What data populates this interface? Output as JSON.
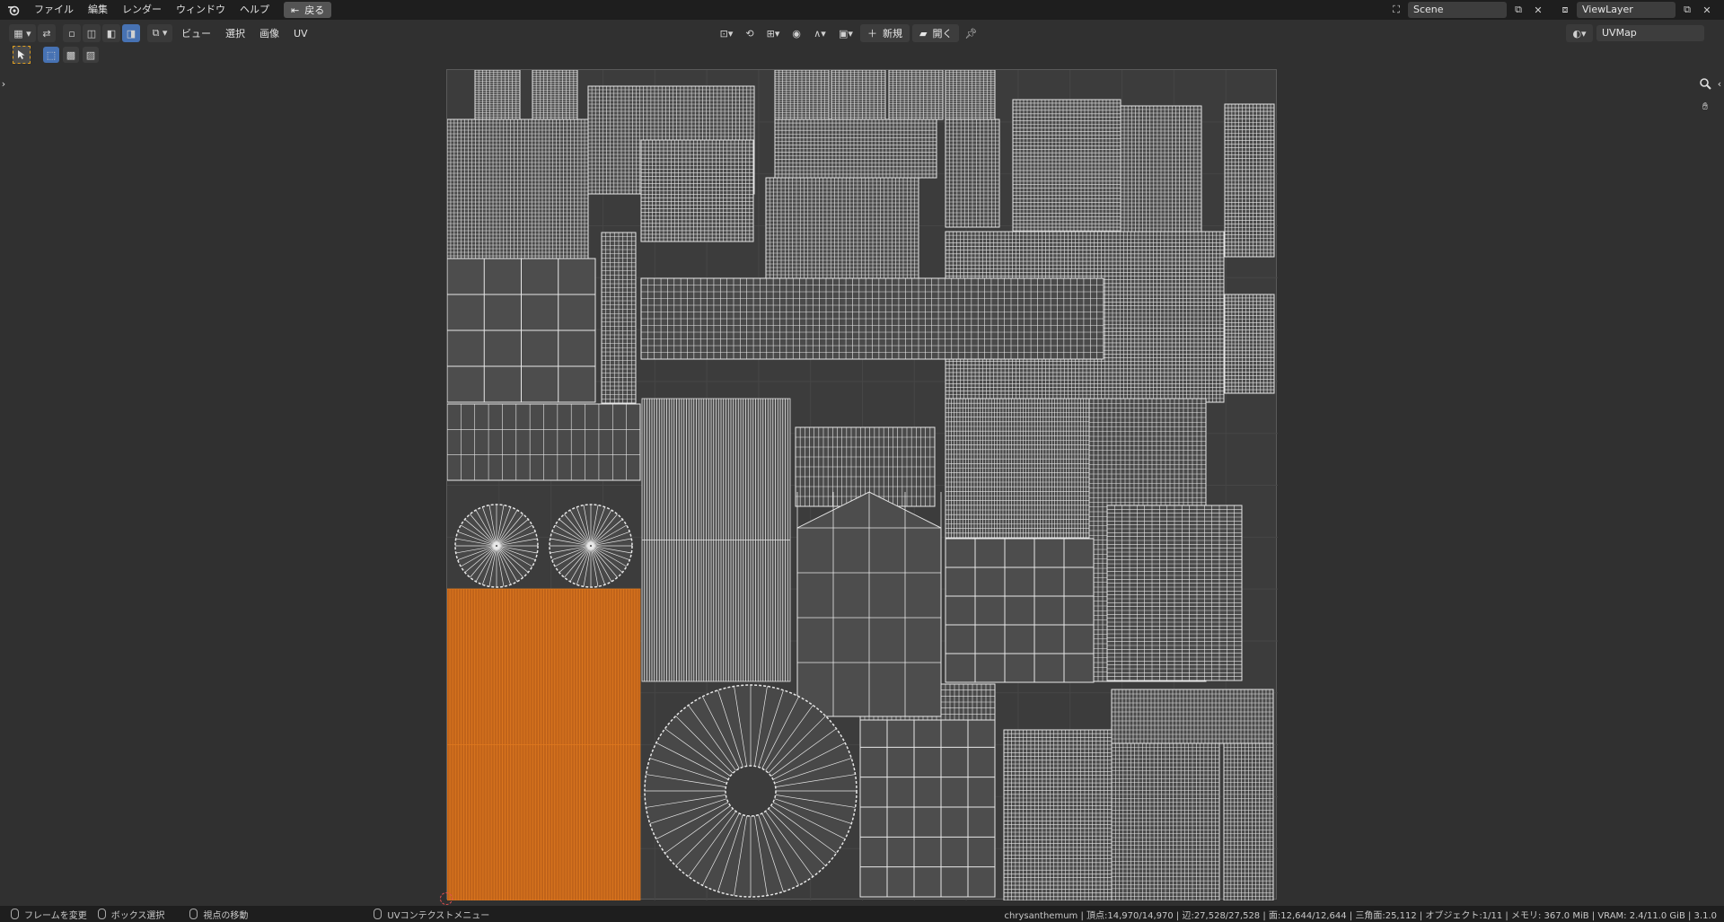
{
  "topbar": {
    "menus": [
      "ファイル",
      "編集",
      "レンダー",
      "ウィンドウ",
      "ヘルプ"
    ],
    "back_label": "戻る",
    "scene": "Scene",
    "view_layer": "ViewLayer"
  },
  "header": {
    "menus": [
      "ビュー",
      "選択",
      "画像",
      "UV"
    ],
    "new_label": "新規",
    "open_label": "開く",
    "uvmap": "UVMap"
  },
  "status": {
    "item1": "フレームを変更",
    "item2": "ボックス選択",
    "item3": "視点の移動",
    "item4": "UVコンテクストメニュー",
    "stats": "chrysanthemum | 頂点:14,970/14,970 | 辺:27,528/27,528 | 面:12,644/12,644 | 三角面:25,112 | オブジェクト:1/11 | メモリ: 367.0 MiB | VRAM: 2.4/11.0 GiB | 3.1.0"
  },
  "colors": {
    "selected": "#e07a1f",
    "wire": "#e8e8e8",
    "accent": "#4772b3"
  },
  "icons": {
    "logo": "blender-logo-icon",
    "zoom": "zoom-icon",
    "pan": "hand-pan-icon",
    "pin": "pin-icon"
  }
}
